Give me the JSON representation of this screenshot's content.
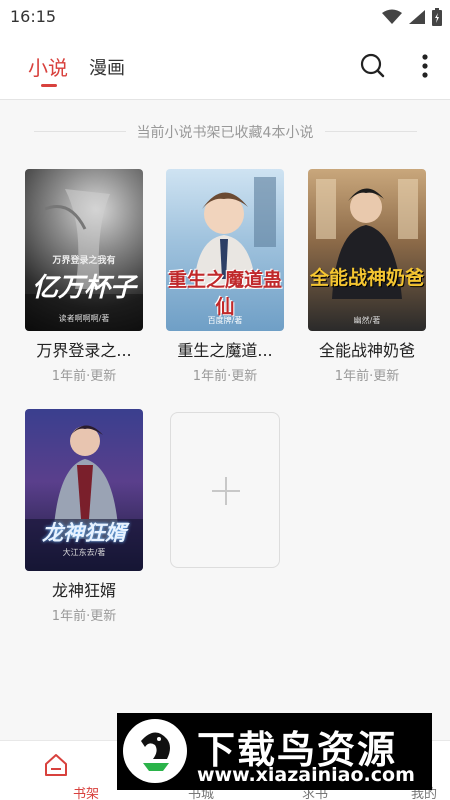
{
  "status_bar": {
    "time": "16:15"
  },
  "header": {
    "tabs": [
      {
        "label": "小说",
        "active": true
      },
      {
        "label": "漫画",
        "active": false
      }
    ],
    "accent_color": "#d8413d"
  },
  "shelf": {
    "summary": "当前小说书架已收藏4本小说",
    "books": [
      {
        "title": "万界登录之...",
        "meta": "1年前·更新",
        "cover_text": "亿万杯子",
        "cover_subtitle": "万界登录之我有",
        "cover_author": "读者啊啊啊/著"
      },
      {
        "title": "重生之魔道...",
        "meta": "1年前·更新",
        "cover_text": "重生之魔道蛊仙",
        "cover_author": "百度牌/著"
      },
      {
        "title": "全能战神奶爸",
        "meta": "1年前·更新",
        "cover_text": "全能战神奶爸",
        "cover_author": "幽然/著"
      },
      {
        "title": "龙神狂婿",
        "meta": "1年前·更新",
        "cover_text": "龙神狂婿",
        "cover_author": "大江东去/著"
      }
    ]
  },
  "bottom_nav": [
    {
      "label": "书架",
      "icon": "home-icon",
      "active": true
    },
    {
      "label": "书城",
      "icon": "store-icon",
      "active": false
    },
    {
      "label": "求书",
      "icon": "request-icon",
      "active": false
    },
    {
      "label": "我的",
      "icon": "profile-icon",
      "active": false
    }
  ],
  "watermark": {
    "title": "下载鸟资源",
    "url": "www.xiazainiao.com"
  }
}
